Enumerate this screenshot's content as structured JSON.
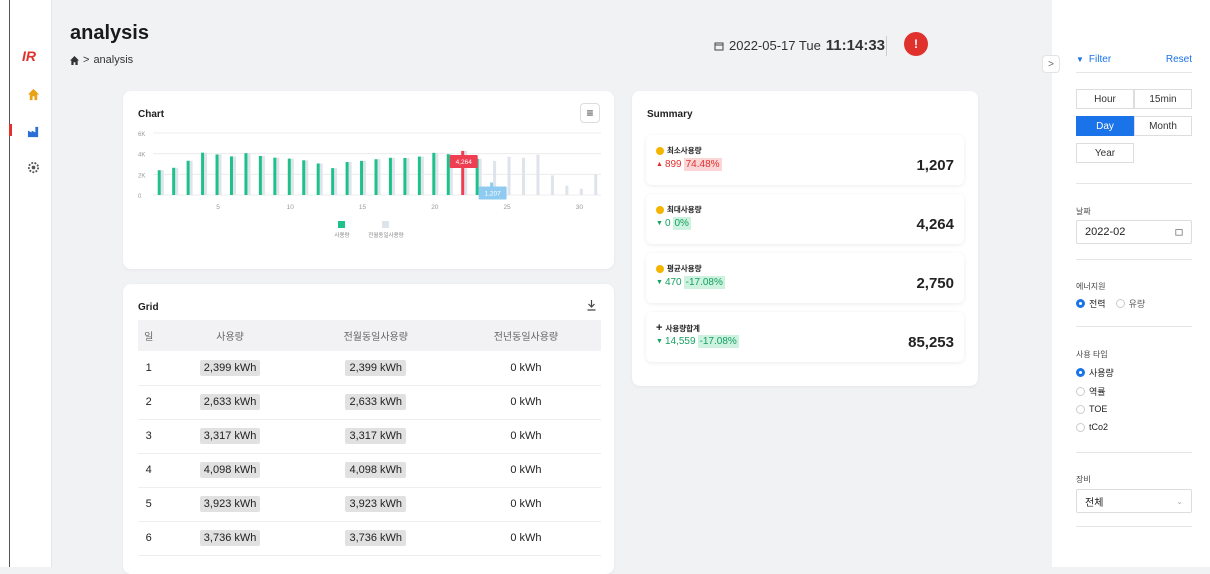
{
  "app": {
    "logo": "IR",
    "title": "analysis",
    "breadcrumb": "analysis"
  },
  "header": {
    "date": "2022-05-17 Tue",
    "time": "11:14:33",
    "alert_badge": "!"
  },
  "sidebar": {
    "icons": [
      "home-icon",
      "factory-icon",
      "settings-icon"
    ]
  },
  "chart_card": {
    "title": "Chart"
  },
  "chart_data": {
    "type": "bar",
    "x": [
      1,
      2,
      3,
      4,
      5,
      6,
      7,
      8,
      9,
      10,
      11,
      12,
      13,
      14,
      15,
      16,
      17,
      18,
      19,
      20,
      21,
      22,
      23,
      24,
      25,
      26,
      27,
      28,
      29,
      30,
      31
    ],
    "xticks": [
      5,
      10,
      15,
      20,
      25,
      30
    ],
    "yticks": [
      "0",
      "2K",
      "4K",
      "6K"
    ],
    "ylim": [
      0,
      6000
    ],
    "series": [
      {
        "name": "사용량",
        "color": "#1fc18a",
        "values": [
          2399,
          2633,
          3317,
          4098,
          3923,
          3736,
          4050,
          3780,
          3610,
          3520,
          3360,
          3050,
          2600,
          3190,
          3300,
          3460,
          3600,
          3580,
          3720,
          4080,
          3950,
          4264,
          3500,
          1207,
          null,
          null,
          null,
          null,
          null,
          null,
          null
        ]
      },
      {
        "name": "전월동일사용량",
        "color": "#dfe3ec",
        "values": [
          2399,
          2633,
          3317,
          4098,
          3923,
          3736,
          4050,
          3780,
          3610,
          3520,
          3360,
          3050,
          2600,
          3190,
          3300,
          3460,
          3600,
          3580,
          3720,
          4080,
          3950,
          4264,
          3500,
          3300,
          3700,
          3600,
          3900,
          1900,
          900,
          600,
          2000
        ]
      }
    ],
    "annotations": [
      {
        "x": 22,
        "label": "4,264",
        "color": "#ef3e51"
      },
      {
        "x": 24,
        "label": "1,207",
        "color": "#8fcbf0"
      }
    ],
    "legend": "bottom"
  },
  "grid_card": {
    "title": "Grid",
    "columns": [
      "일",
      "사용량",
      "전월동일사용량",
      "전년동일사용량"
    ],
    "rows": [
      [
        "1",
        "2,399 kWh",
        "2,399 kWh",
        "0 kWh"
      ],
      [
        "2",
        "2,633 kWh",
        "2,633 kWh",
        "0 kWh"
      ],
      [
        "3",
        "3,317 kWh",
        "3,317 kWh",
        "0 kWh"
      ],
      [
        "4",
        "4,098 kWh",
        "4,098 kWh",
        "0 kWh"
      ],
      [
        "5",
        "3,923 kWh",
        "3,923 kWh",
        "0 kWh"
      ],
      [
        "6",
        "3,736 kWh",
        "3,736 kWh",
        "0 kWh"
      ]
    ]
  },
  "summary": {
    "title": "Summary",
    "items": [
      {
        "label": "최소사용량",
        "delta": "899",
        "pct": "74.48%",
        "trend": "up-red",
        "value": "1,207"
      },
      {
        "label": "최대사용량",
        "delta": "0",
        "pct": "0%",
        "trend": "green",
        "value": "4,264"
      },
      {
        "label": "평균사용량",
        "delta": "470",
        "pct": "-17.08%",
        "trend": "green",
        "value": "2,750"
      },
      {
        "label": "사용량합계",
        "delta": "14,559",
        "pct": "-17.08%",
        "trend": "green",
        "value": "85,253"
      }
    ]
  },
  "filter": {
    "title": "Filter",
    "reset": "Reset",
    "periods": [
      "Hour",
      "15min",
      "Day",
      "Month",
      "Year"
    ],
    "active_period": "Day",
    "date_label": "날짜",
    "date_value": "2022-02",
    "energy_label": "에너지원",
    "energy_options": [
      "전력",
      "유량"
    ],
    "usage_type_label": "사용 타입",
    "usage_types": [
      "사용량",
      "역률",
      "TOE",
      "tCo2"
    ],
    "device_label": "장비",
    "device_value": "전체"
  }
}
